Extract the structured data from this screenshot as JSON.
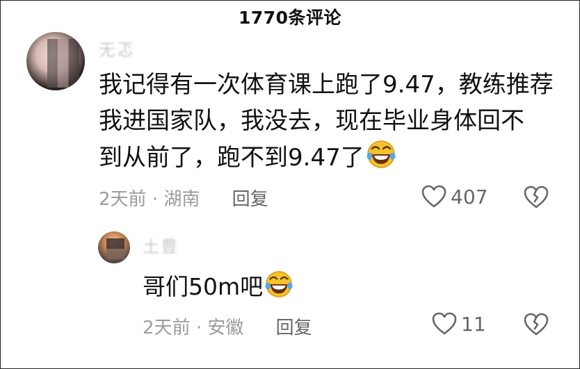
{
  "header": {
    "title": "1770条评论"
  },
  "comment": {
    "username": "无忑",
    "lines": [
      "我记得有一次体育课上跑了9.47，教练推荐",
      "我进国家队，我没去，现在毕业身体回不",
      "到从前了，跑不到9.47了"
    ],
    "emoji": "laughing-tears-emoji",
    "time": "2天前",
    "separator": "·",
    "location": "湖南",
    "reply_label": "回复",
    "like_count": "407"
  },
  "reply": {
    "username": "土豊",
    "text": "哥们50m吧",
    "emoji": "laughing-tears-emoji",
    "time": "2天前",
    "separator": "·",
    "location": "安徽",
    "reply_label": "回复",
    "like_count": "11"
  },
  "colors": {
    "text": "#111111",
    "meta": "#9b9b9b",
    "icon": "#666666",
    "emoji_face": "#f7c12c"
  }
}
